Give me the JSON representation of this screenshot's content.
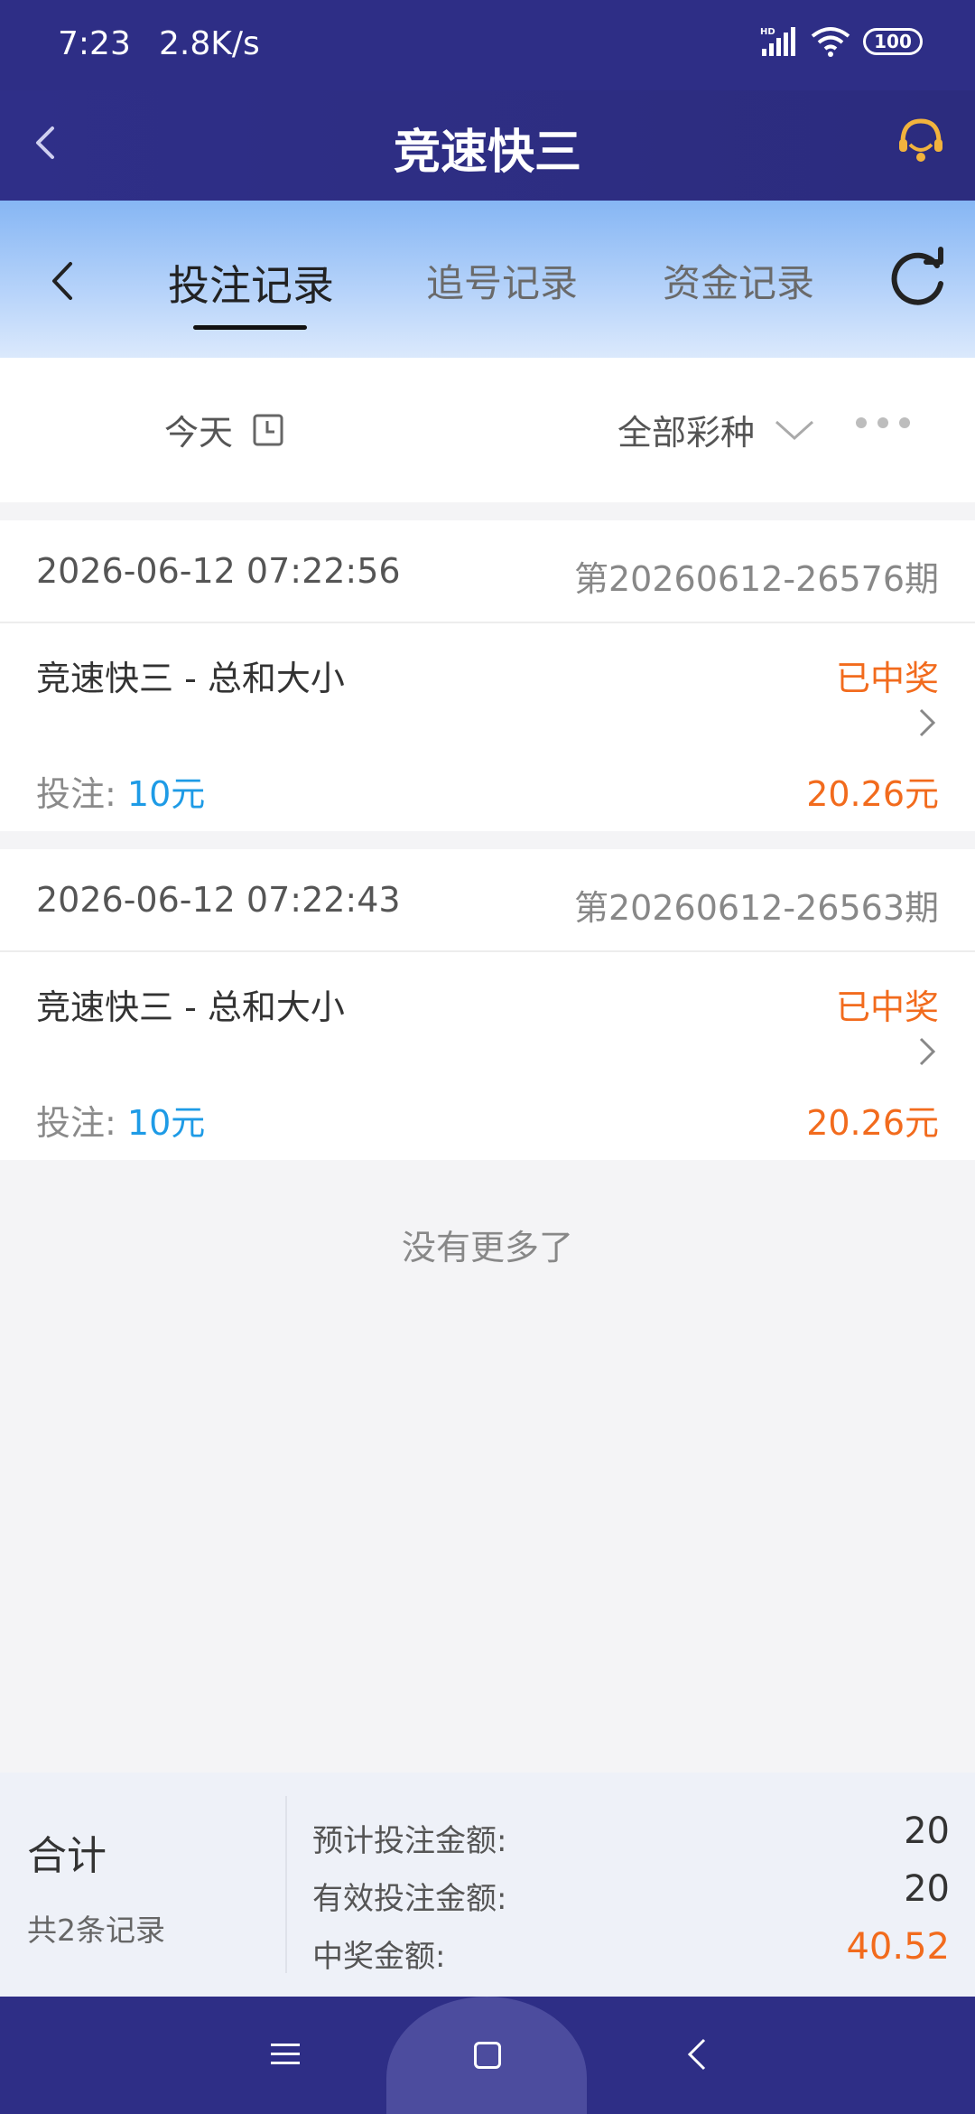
{
  "status_bar": {
    "time": "7:23",
    "speed": "2.8K/s",
    "signal_label": "HD",
    "battery": "100"
  },
  "header": {
    "title": "竞速快三"
  },
  "tabs": [
    {
      "label": "投注记录",
      "active": true
    },
    {
      "label": "追号记录",
      "active": false
    },
    {
      "label": "资金记录",
      "active": false
    }
  ],
  "filters": {
    "date": "今天",
    "lottery": "全部彩种"
  },
  "records": [
    {
      "time": "2026-06-12 07:22:56",
      "period": "第20260612-26576期",
      "name": "竞速快三 - 总和大小",
      "status": "已中奖",
      "bet_label": "投注: ",
      "bet_amount": "10元",
      "prize": "20.26元"
    },
    {
      "time": "2026-06-12 07:22:43",
      "period": "第20260612-26563期",
      "name": "竞速快三 - 总和大小",
      "status": "已中奖",
      "bet_label": "投注: ",
      "bet_amount": "10元",
      "prize": "20.26元"
    }
  ],
  "no_more": "没有更多了",
  "summary": {
    "title": "合计",
    "count": "共2条记录",
    "expected_label": "预计投注金额:",
    "expected_value": "20",
    "valid_label": "有效投注金额:",
    "valid_value": "20",
    "prize_label": "中奖金额:",
    "prize_value": "40.52"
  },
  "colors": {
    "header": "#2e2e86",
    "win": "#f26b1d",
    "bet_amount": "#1e9be6"
  }
}
